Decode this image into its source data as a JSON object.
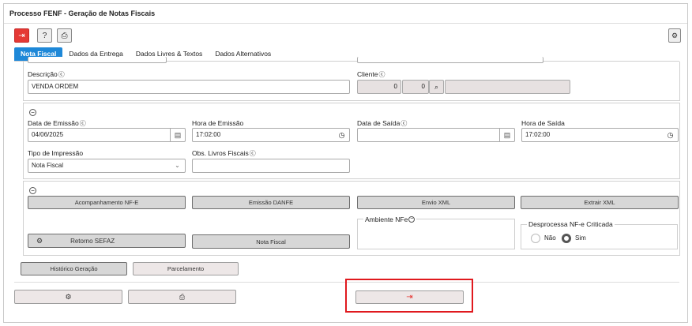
{
  "window": {
    "title": "Processo FENF - Geração de Notas Fiscais"
  },
  "toolbar": {
    "exit_icon": "exit-icon",
    "help_label": "?",
    "print_icon": "printer-icon",
    "settings_icon": "gear-icon"
  },
  "tabs": [
    "Nota Fiscal",
    "Dados da Entrega",
    "Dados Livres & Textos",
    "Dados Alternativos"
  ],
  "form": {
    "descricao_label": "Descrição",
    "descricao_value": "VENDA ORDEM",
    "cliente_label": "Cliente",
    "cliente_val1": "0",
    "cliente_val2": "0",
    "data_emissao_label": "Data de Emissão",
    "data_emissao_value": "04/06/2025",
    "hora_emissao_label": "Hora de Emissão",
    "hora_emissao_value": "17:02:00",
    "data_saida_label": "Data de Saída",
    "data_saida_value": "",
    "hora_saida_label": "Hora de Saída",
    "hora_saida_value": "17:02:00",
    "tipo_impressao_label": "Tipo de Impressão",
    "tipo_impressao_value": "Nota Fiscal",
    "obs_livros_label": "Obs. Livros Fiscais",
    "obs_livros_value": ""
  },
  "actions": {
    "acompanhamento": "Acompanhamento NF-E",
    "emissao_danfe": "Emissão DANFE",
    "envio_xml": "Envio XML",
    "extrair_xml": "Extrair XML",
    "ambiente_label": "Ambiente NFe",
    "desprocessa_label": "Desprocessa NF-e Criticada",
    "radio_nao": "Não",
    "radio_sim": "Sim",
    "radio_selected": "Sim",
    "retorno_sefaz": "Retorno SEFAZ",
    "nota_fiscal": "Nota Fiscal"
  },
  "lower": {
    "historico": "Histórico Geração",
    "parcelamento": "Parcelamento"
  },
  "colors": {
    "tab_active": "#1e88d8",
    "exit_red": "#e53935",
    "highlight": "#e0191e"
  }
}
